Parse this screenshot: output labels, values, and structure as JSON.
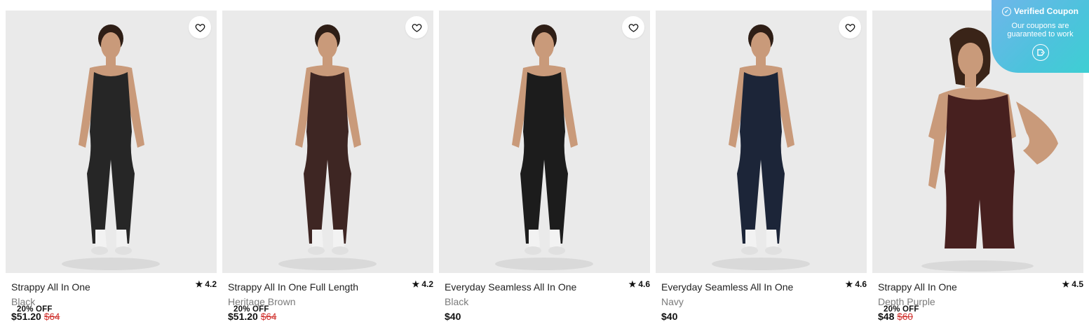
{
  "products": [
    {
      "name": "Strappy All In One",
      "color": "Black",
      "price": "$51.20",
      "was": "$64",
      "badge": "20% OFF",
      "rating": "4.2",
      "garment": "#262626",
      "style": "full"
    },
    {
      "name": "Strappy All In One Full Length",
      "color": "Heritage Brown",
      "price": "$51.20",
      "was": "$64",
      "badge": "20% OFF",
      "rating": "4.2",
      "garment": "#3e2623",
      "style": "full"
    },
    {
      "name": "Everyday Seamless All In One",
      "color": "Black",
      "price": "$40",
      "was": "",
      "badge": "",
      "rating": "4.6",
      "garment": "#1c1c1c",
      "style": "full"
    },
    {
      "name": "Everyday Seamless All In One",
      "color": "Navy",
      "price": "$40",
      "was": "",
      "badge": "",
      "rating": "4.6",
      "garment": "#1c2538",
      "style": "full"
    },
    {
      "name": "Strappy All In One",
      "color": "Depth Purple",
      "price": "$48",
      "was": "$60",
      "badge": "20% OFF",
      "rating": "4.5",
      "garment": "#47201f",
      "style": "short"
    }
  ],
  "icons": {
    "wishlist": "heart-icon",
    "rating": "star-icon",
    "verified": "check-circle-icon",
    "coupon": "coupon-tag-icon"
  },
  "coupon": {
    "title": "Verified Coupon",
    "subtitle": "Our coupons are guaranteed to work"
  },
  "colors": {
    "sale": "#d0312d",
    "badge_bg": "#ffffff",
    "image_bg": "#eaeaea",
    "coupon_gradient_start": "#6fb6ea",
    "coupon_gradient_end": "#3ecfd3"
  }
}
